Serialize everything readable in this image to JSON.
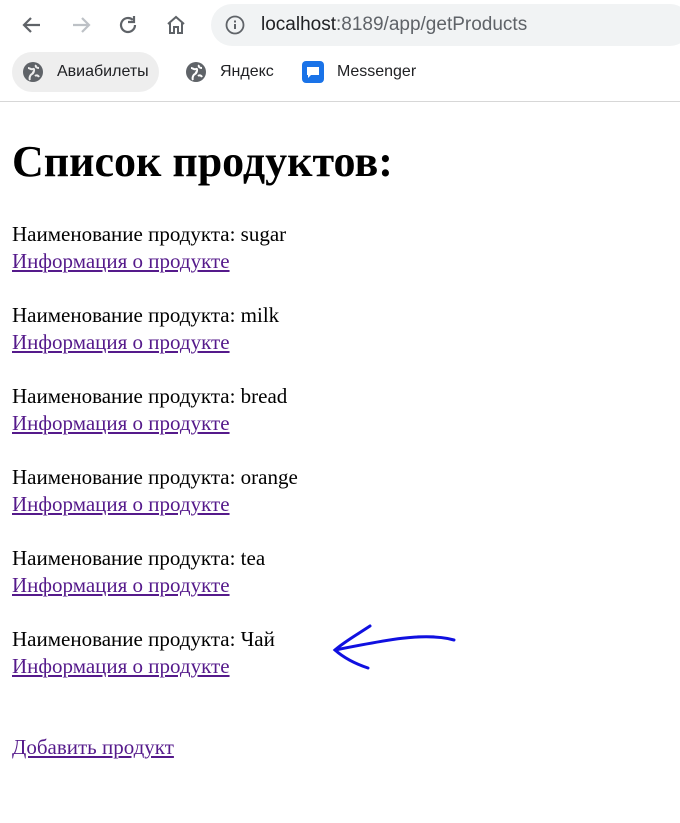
{
  "browser": {
    "url_host": "localhost",
    "url_rest": ":8189/app/getProducts",
    "bookmarks": [
      {
        "label": "Авиабилеты",
        "icon": "globe-icon"
      },
      {
        "label": "Яндекс",
        "icon": "globe-icon"
      },
      {
        "label": "Messenger",
        "icon": "messenger-icon"
      }
    ]
  },
  "page": {
    "title": "Список продуктов:",
    "products": [
      {
        "name_text": "Наименование продукта: sugar",
        "link": "Информация о продукте"
      },
      {
        "name_text": "Наименование продукта: milk",
        "link": "Информация о продукте"
      },
      {
        "name_text": "Наименование продукта: bread",
        "link": "Информация о продукте"
      },
      {
        "name_text": "Наименование продукта: orange",
        "link": "Информация о продукте"
      },
      {
        "name_text": "Наименование продукта: tea",
        "link": "Информация о продукте"
      },
      {
        "name_text": "Наименование продукта: Чай",
        "link": "Информация о продукте"
      }
    ],
    "add_link": "Добавить продукт"
  },
  "colors": {
    "link": "#551a8b",
    "annotation_arrow": "#1010e0"
  }
}
